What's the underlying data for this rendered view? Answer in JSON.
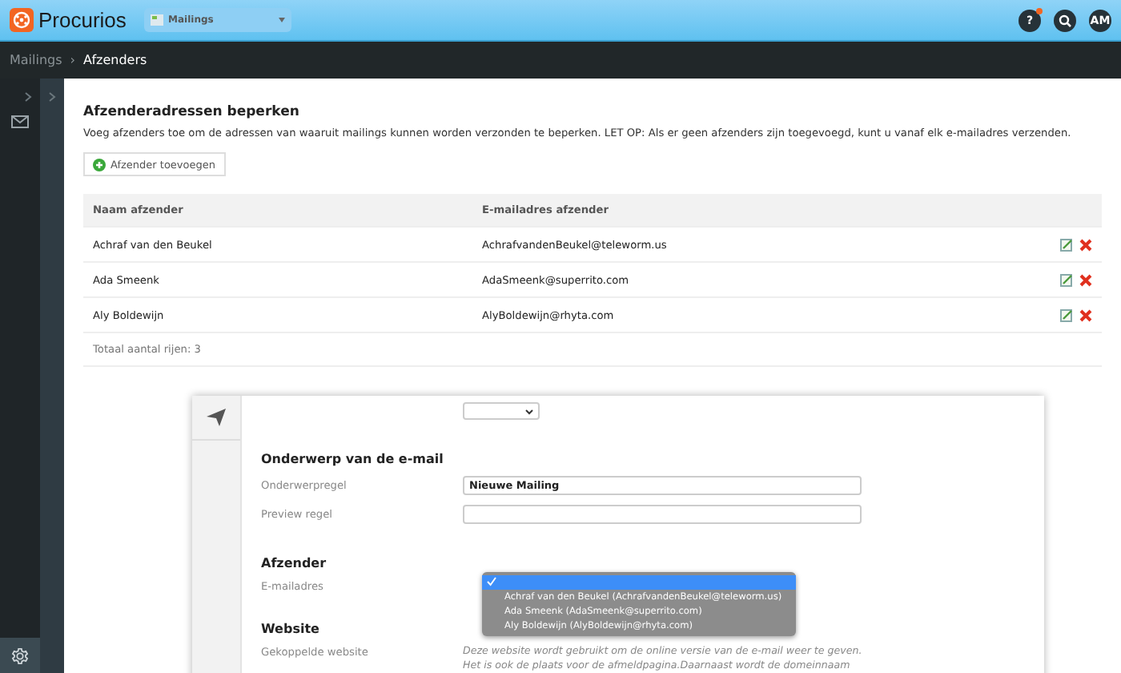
{
  "topbar": {
    "brand": "Procurios",
    "module_select": "Mailings",
    "help_button": "?",
    "help_notification": true,
    "avatar": "AM"
  },
  "breadcrumb": [
    "Mailings",
    "›",
    "Afzenders"
  ],
  "page": {
    "title": "Afzenderadressen beperken",
    "description": "Voeg afzenders toe om de adressen van waaruit mailings kunnen worden verzonden te beperken. LET OP: Als er geen afzenders zijn toegevoegd, kunt u vanaf elk e-mailadres verzenden.",
    "add_button": "Afzender toevoegen"
  },
  "table": {
    "columns": [
      "Naam afzender",
      "E-mailadres afzender"
    ],
    "rows": [
      {
        "name": "Achraf van den Beukel",
        "email": "AchrafvandenBeukel@teleworm.us"
      },
      {
        "name": "Ada Smeenk",
        "email": "AdaSmeenk@superrito.com"
      },
      {
        "name": "Aly Boldewijn",
        "email": "AlyBoldewijn@rhyta.com"
      }
    ],
    "footer": "Totaal aantal rijen: 3"
  },
  "inset": {
    "subject_heading": "Onderwerp van de e-mail",
    "fields": [
      {
        "label": "Onderwerpregel",
        "value": "Nieuwe Mailing"
      },
      {
        "label": "Preview regel"
      }
    ],
    "sender_heading": "Afzender",
    "sender_label": "E-mailadres",
    "sender_options": [
      {
        "selected": true
      },
      {
        "label": "Achraf van den Beukel (AchrafvandenBeukel@teleworm.us)",
        "selected": false
      },
      {
        "label": "Ada Smeenk (AdaSmeenk@superrito.com)",
        "selected": false
      },
      {
        "label": "Aly Boldewijn (AlyBoldewijn@rhyta.com)",
        "selected": false
      }
    ],
    "website_heading": "Website",
    "website_label": "Gekoppelde website",
    "website_help": [
      "Deze website wordt gebruikt om de online versie van de e-mail weer te geven.",
      "Het is ook de plaats voor de afmeldpagina.Daarnaast wordt de domeinnaam"
    ]
  }
}
